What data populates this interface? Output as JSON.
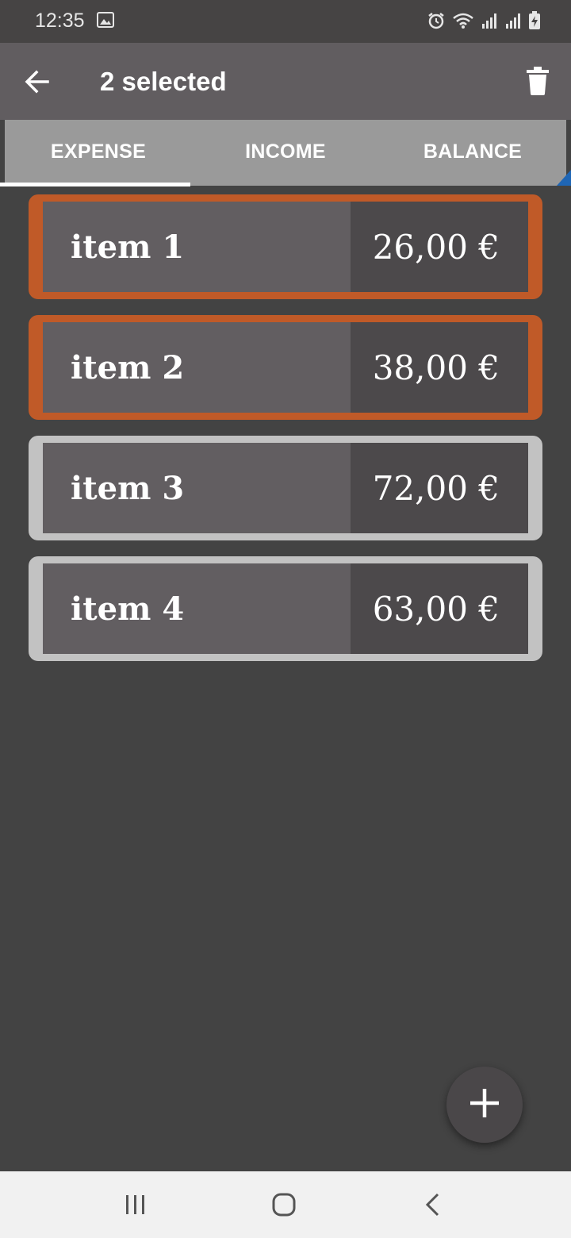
{
  "status_bar": {
    "time": "12:35",
    "icons": [
      "gallery-icon",
      "alarm-icon",
      "wifi-icon",
      "signal-icon",
      "signal-icon",
      "battery-charging-icon"
    ]
  },
  "toolbar": {
    "title": "2 selected",
    "back_icon": "arrow-left-icon",
    "delete_icon": "trash-icon"
  },
  "tabs": [
    {
      "label": "EXPENSE",
      "active": true
    },
    {
      "label": "INCOME",
      "active": false
    },
    {
      "label": "BALANCE",
      "active": false
    }
  ],
  "items": [
    {
      "name": "item 1",
      "amount": "26,00 €",
      "selected": true
    },
    {
      "name": "item 2",
      "amount": "38,00 €",
      "selected": true
    },
    {
      "name": "item 3",
      "amount": "72,00 €",
      "selected": false
    },
    {
      "name": "item 4",
      "amount": "63,00 €",
      "selected": false
    }
  ],
  "fab": {
    "icon": "plus-icon"
  },
  "nav_bar": {
    "icons": [
      "recents-icon",
      "home-icon",
      "back-icon"
    ]
  },
  "colors": {
    "selected_border": "#c05a28",
    "unselected_border": "#c2c2c2",
    "toolbar": "#615d60",
    "background": "#434343"
  }
}
